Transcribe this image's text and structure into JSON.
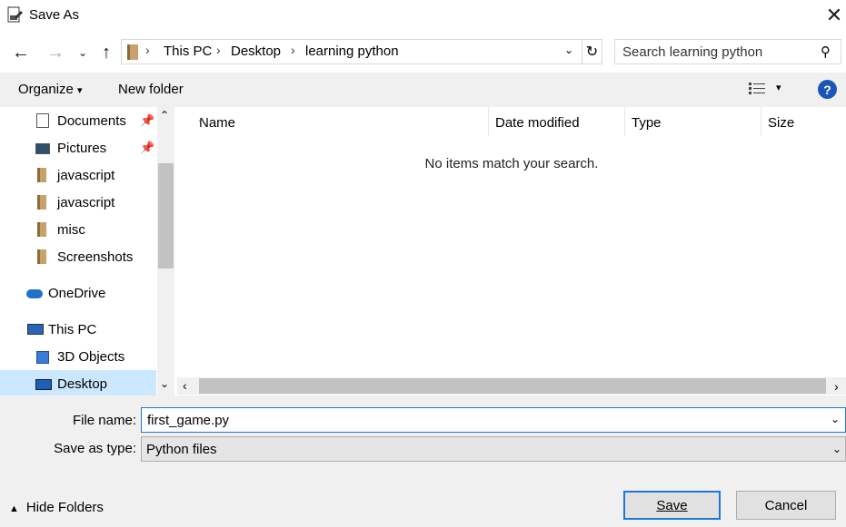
{
  "window": {
    "title": "Save As",
    "close_glyph": "✕"
  },
  "nav": {
    "back_glyph": "←",
    "forward_glyph": "→",
    "recent_glyph": "⌄",
    "up_glyph": "↑",
    "breadcrumbs": [
      "This PC",
      "Desktop",
      "learning python"
    ],
    "chevron": "›",
    "dropdown_glyph": "⌄",
    "refresh_glyph": "↻",
    "search_placeholder": "Search learning python",
    "search_glyph": "⚲"
  },
  "toolbar": {
    "organize_label": "Organize",
    "organize_caret": "▾",
    "new_folder_label": "New folder",
    "view_caret": "▾",
    "help_label": "?"
  },
  "sidebar": {
    "items": [
      {
        "label": "Documents",
        "icon": "documents-icon",
        "pinned": true
      },
      {
        "label": "Pictures",
        "icon": "pictures-icon",
        "pinned": true
      },
      {
        "label": "javascript",
        "icon": "folder-icon"
      },
      {
        "label": "javascript",
        "icon": "folder-icon"
      },
      {
        "label": "misc",
        "icon": "folder-icon"
      },
      {
        "label": "Screenshots",
        "icon": "folder-icon"
      },
      {
        "label": "OneDrive",
        "icon": "onedrive-icon"
      },
      {
        "label": "This PC",
        "icon": "this-pc-icon"
      },
      {
        "label": "3D Objects",
        "icon": "3d-objects-icon"
      },
      {
        "label": "Desktop",
        "icon": "desktop-icon",
        "selected": true
      }
    ],
    "pin_glyph": "📌",
    "scroll_up": "⌃",
    "scroll_down": "⌄"
  },
  "filelist": {
    "columns": [
      "Name",
      "Date modified",
      "Type",
      "Size"
    ],
    "sort_glyph": "^",
    "empty_message": "No items match your search.",
    "scroll_left": "‹",
    "scroll_right": "›"
  },
  "form": {
    "file_name_label": "File name:",
    "file_name_value": "first_game.py",
    "save_as_type_label": "Save as type:",
    "save_as_type_value": "Python files",
    "dropdown_glyph": "⌄"
  },
  "footer": {
    "hide_folders_caret": "▲",
    "hide_folders_label": "Hide Folders",
    "save_label": "Save",
    "cancel_label": "Cancel"
  },
  "colors": {
    "accent": "#1b78d6",
    "selection": "#cce8ff",
    "chrome": "#f0f0f0"
  }
}
